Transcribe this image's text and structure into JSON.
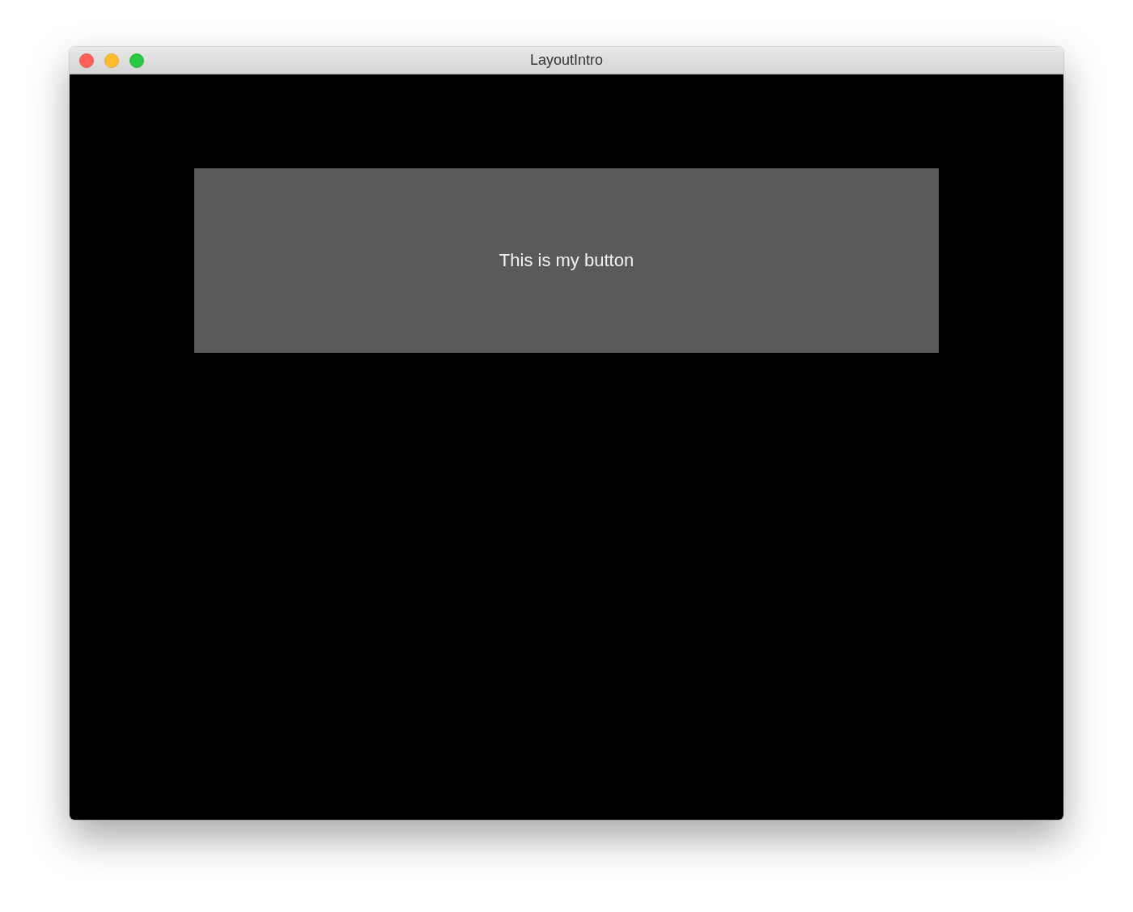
{
  "window": {
    "title": "LayoutIntro"
  },
  "button": {
    "label": "This is my button"
  }
}
